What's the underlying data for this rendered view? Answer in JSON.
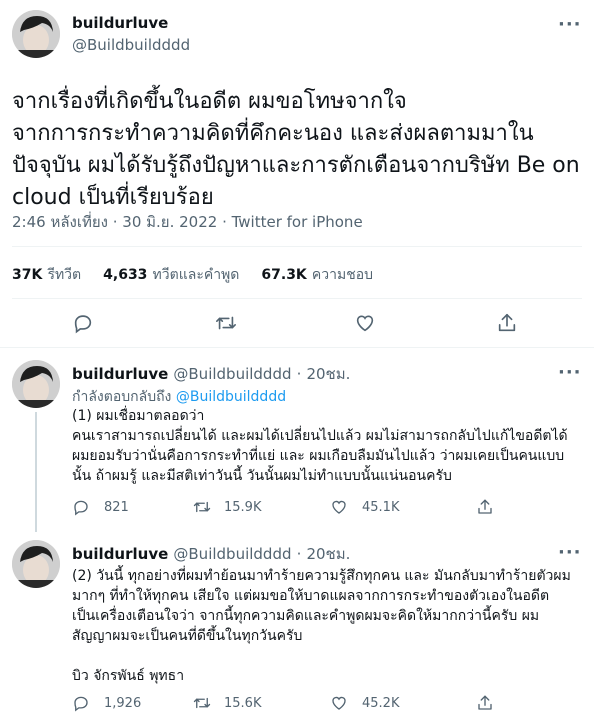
{
  "main_tweet": {
    "display_name": "buildurluve",
    "handle": "@Buildbuildddd",
    "text_lines": [
      "จากเรื่องที่เกิดขึ้นในอดีต ผมขอโทษจากใจ",
      "จากการกระทำความคิดที่คึกคะนอง และส่งผลตามมาใน",
      "ปัจจุบัน ผมได้รับรู้ถึงปัญหาและการตักเตือนจากบริษัท Be on",
      "cloud เป็นที่เรียบร้อย"
    ],
    "timestamp": "2:46 หลังเที่ยง · 30 มิ.ย. 2022 · Twitter for iPhone",
    "stats": {
      "retweets_num": "37K",
      "retweets_label": "รีทวีต",
      "quotes_num": "4,633",
      "quotes_label": "ทวีตและคำพูด",
      "likes_num": "67.3K",
      "likes_label": "ความชอบ"
    },
    "action_icons": [
      "reply-icon",
      "retweet-icon",
      "like-icon",
      "share-icon"
    ]
  },
  "replies": [
    {
      "display_name": "buildurluve",
      "handle": "@Buildbuildddd",
      "time": "20ชม.",
      "replying_prefix": "กำลังตอบกลับถึง",
      "replying_to": "@Buildbuildddd",
      "text": "(1) ผมเชื่อมาตลอดว่า\nคนเราสามารถเปลี่ยนได้ และผมได้เปลี่ยนไปแล้ว ผมไม่สามารถกลับไปแก้ไขอดีตได้\nผมยอมรับว่านั่นคือการกระทำที่แย่ และ ผมเกือบลืมมันไปแล้ว ว่าผมเคยเป็นคนแบบ\nนั้น ถ้าผมรู้ และมีสติเท่าวันนี้ วันนั้นผมไม่ทำแบบนั้นแน่นอนครับ",
      "reply_count": "821",
      "retweet_count": "15.9K",
      "like_count": "45.1K"
    },
    {
      "display_name": "buildurluve",
      "handle": "@Buildbuildddd",
      "time": "20ชม.",
      "text": "(2) วันนี้ ทุกอย่างที่ผมทำย้อนมาทำร้ายความรู้สึกทุกคน และ มันกลับมาทำร้ายตัวผม\nมากๆ ที่ทำให้ทุกคน เสียใจ แต่ผมขอให้บาดแผลจากการกระทำของตัวเองในอดีต\nเป็นเครื่องเตือนใจว่า จากนี้ทุกความคิดและคำพูดผมจะคิดให้มากกว่านี้ครับ ผม\nสัญญาผมจะเป็นคนที่ดีขึ้นในทุกวันครับ\n\nบิว จักรพันธ์ พุทธา",
      "reply_count": "1,926",
      "retweet_count": "15.6K",
      "like_count": "45.2K"
    }
  ],
  "more_icon": "more-dots-icon"
}
